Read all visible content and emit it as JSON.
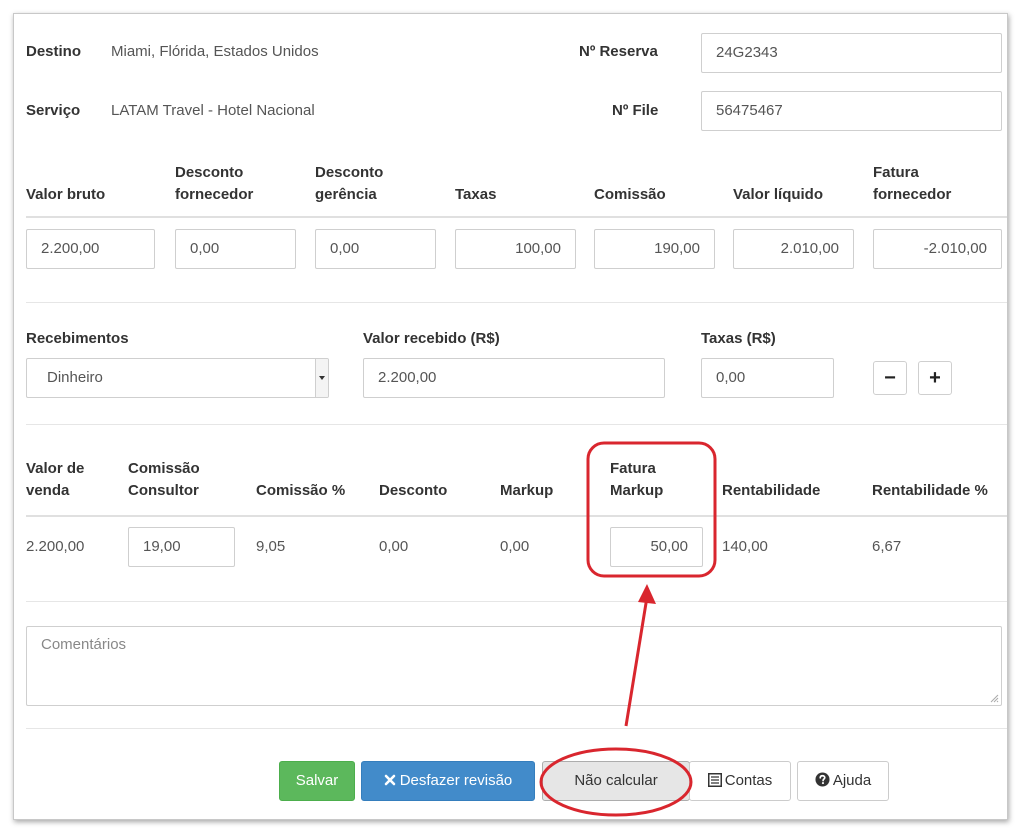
{
  "booking": {
    "destino_label": "Destino",
    "destino_value": "Miami, Flórida, Estados Unidos",
    "servico_label": "Serviço",
    "servico_value": "LATAM Travel - Hotel Nacional",
    "reserva_label": "Nº Reserva",
    "reserva_value": "24G2343",
    "file_label": "Nº File",
    "file_value": "56475467"
  },
  "values_table": {
    "headers": [
      {
        "line1": "",
        "line2": "Valor bruto"
      },
      {
        "line1": "Desconto",
        "line2": "fornecedor"
      },
      {
        "line1": "Desconto",
        "line2": "gerência"
      },
      {
        "line1": "",
        "line2": "Taxas"
      },
      {
        "line1": "",
        "line2": "Comissão"
      },
      {
        "line1": "",
        "line2": "Valor líquido"
      },
      {
        "line1": "Fatura",
        "line2": "fornecedor"
      }
    ],
    "values": [
      "2.200,00",
      "0,00",
      "0,00",
      "100,00",
      "190,00",
      "2.010,00",
      "-2.010,00"
    ]
  },
  "payments": {
    "recebimentos_label": "Recebimentos",
    "recebimentos_value": "Dinheiro",
    "valor_recebido_label": "Valor recebido (R$)",
    "valor_recebido_value": "2.200,00",
    "taxas_label": "Taxas (R$)",
    "taxas_value": "0,00",
    "minus_label": "−",
    "plus_label": "+"
  },
  "summary_table": {
    "headers": [
      {
        "line1": "Valor de",
        "line2": "venda"
      },
      {
        "line1": "Comissão",
        "line2": "Consultor"
      },
      {
        "line1": "",
        "line2": "Comissão %"
      },
      {
        "line1": "",
        "line2": "Desconto"
      },
      {
        "line1": "",
        "line2": "Markup"
      },
      {
        "line1": "Fatura",
        "line2": "Markup"
      },
      {
        "line1": "",
        "line2": "Rentabilidade"
      },
      {
        "line1": "",
        "line2": "Rentabilidade %"
      }
    ],
    "values": [
      "2.200,00",
      "19,00",
      "9,05",
      "0,00",
      "0,00",
      "50,00",
      "140,00",
      "6,67"
    ]
  },
  "comments": {
    "placeholder": "Comentários"
  },
  "actions": {
    "salvar": "Salvar",
    "desfazer": "Desfazer revisão",
    "nao_calcular": "Não calcular",
    "contas": "Contas",
    "ajuda": "Ajuda"
  },
  "annotation": {
    "color": "#d9262e"
  },
  "icons": [
    "close-icon",
    "list-icon",
    "help-icon",
    "resize-grip-icon",
    "dropdown-caret-icon"
  ]
}
